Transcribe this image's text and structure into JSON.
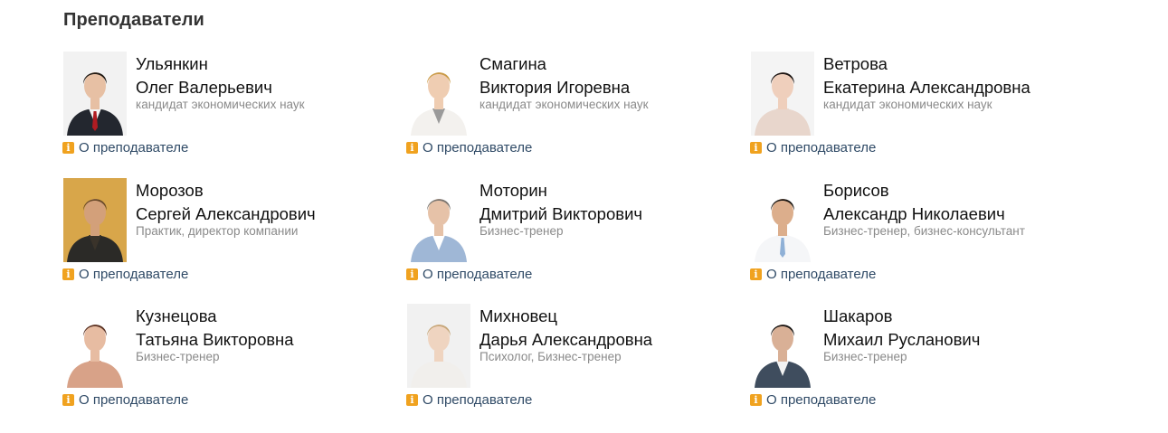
{
  "section": {
    "title": "Преподаватели"
  },
  "teachers": [
    {
      "surname": "Ульянкин",
      "given": "Олег Валерьевич",
      "degree": "кандидат экономических наук",
      "about_label": "О преподавателе",
      "skin": "#e7c0a4",
      "hair": "#1e1812",
      "suit": "#23272f",
      "shirt": "#f4f4f4",
      "tie": "#b01c22",
      "bg": "#f2f2f2"
    },
    {
      "surname": "Смагина",
      "given": "Виктория Игоревна",
      "degree": "кандидат экономических наук",
      "about_label": "О преподавателе",
      "skin": "#efcdb2",
      "hair": "#c99a45",
      "suit": "#f3f1ee",
      "shirt": "#9a9a9a",
      "tie": "",
      "bg": "#ffffff"
    },
    {
      "surname": "Ветрова",
      "given": "Екатерина Александровна",
      "degree": "кандидат экономических наук",
      "about_label": "О преподавателе",
      "skin": "#efcfbc",
      "hair": "#1a1412",
      "suit": "#e8d6cc",
      "shirt": "#e8d6cc",
      "tie": "",
      "bg": "#f4f4f4"
    },
    {
      "surname": "Морозов",
      "given": "Сергей Александрович",
      "degree": "Практик, директор компании",
      "about_label": "О преподавателе",
      "skin": "#d3a07a",
      "hair": "#6a4a2a",
      "suit": "#2b2a27",
      "shirt": "#3a332a",
      "tie": "",
      "bg": "#d8a64a"
    },
    {
      "surname": "Моторин",
      "given": "Дмитрий Викторович",
      "degree": "Бизнес-тренер",
      "about_label": "О преподавателе",
      "skin": "#e6c2a8",
      "hair": "#7a7570",
      "suit": "#9fb7d6",
      "shirt": "#ffffff",
      "tie": "",
      "bg": "#ffffff"
    },
    {
      "surname": "Борисов",
      "given": "Александр Николаевич",
      "degree": "Бизнес-тренер, бизнес-консультант",
      "about_label": "О преподавателе",
      "skin": "#dcae8c",
      "hair": "#1c1814",
      "suit": "#f5f6f8",
      "shirt": "#f5f6f8",
      "tie": "#8fb0d6",
      "bg": "#ffffff"
    },
    {
      "surname": "Кузнецова",
      "given": "Татьяна Викторовна",
      "degree": "Бизнес-тренер",
      "about_label": "О преподавателе",
      "skin": "#e7bca2",
      "hair": "#5b3324",
      "suit": "#d8a288",
      "shirt": "#d8a288",
      "tie": "",
      "bg": "#ffffff"
    },
    {
      "surname": "Михновец",
      "given": "Дарья Александровна",
      "degree": "Психолог, Бизнес-тренер",
      "about_label": "О преподавателе",
      "skin": "#efd4c0",
      "hair": "#c7a77a",
      "suit": "#f1efec",
      "shirt": "#f1efec",
      "tie": "",
      "bg": "#f1f1f1"
    },
    {
      "surname": "Шакаров",
      "given": "Михаил Русланович",
      "degree": "Бизнес-тренер",
      "about_label": "О преподавателе",
      "skin": "#d9b096",
      "hair": "#1b1816",
      "suit": "#3f4d5e",
      "shirt": "#f2f2f2",
      "tie": "",
      "bg": "#ffffff"
    }
  ],
  "icons": {
    "info": "info-icon",
    "portrait": "teacher-photo"
  },
  "colors": {
    "accent": "#f0a21f",
    "link": "#2f4a66",
    "muted": "#8a8a8a"
  }
}
